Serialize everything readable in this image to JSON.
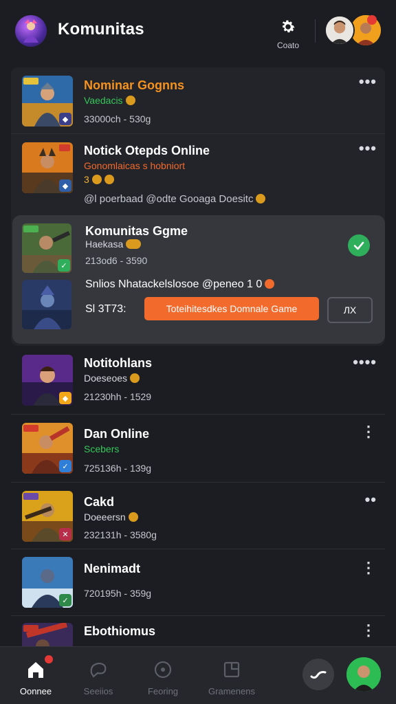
{
  "header": {
    "title": "Komunitas",
    "settings_label": "Coato"
  },
  "items": [
    {
      "title": "Nominar Gognns",
      "subtitle": "Vaedacis",
      "meta": "33000ch - 530g",
      "title_color": "#f6921e",
      "sub_color": "#35c759",
      "badge_color": "#3b3f8a"
    },
    {
      "title": "Notick Otepds Online",
      "subtitle": "Gonomlaicas s hobniort",
      "extra": "3",
      "meta": "@l poerbaad @odte Gooaga Doesitc",
      "sub_color": "#f26a2c",
      "badge_color": "#2f5fa8"
    }
  ],
  "selected": {
    "title": "Komunitas Ggme",
    "subtitle": "Haekasa",
    "meta": "213od6 - 3590",
    "description": "Snlios Nhatackelslosoe @peneo 1 0",
    "price": "Sl 3Т73:",
    "cta_label": "Toteihitesdkes Domnale Game",
    "cancel_label": "ЛX"
  },
  "lower_items": [
    {
      "title": "Notitohlans",
      "subtitle": "Doeseoes",
      "meta": "21230hh - 1529",
      "sub_color": "#d7d9e0",
      "more": "••••"
    },
    {
      "title": "Dan Online",
      "subtitle": "Scebers",
      "meta": "725136h - 139g",
      "sub_color": "#35c759",
      "more": "⋮"
    },
    {
      "title": "Cakd",
      "subtitle": "Doeeersn",
      "meta": "232131h - 3580g",
      "sub_color": "#d7d9e0",
      "more": "••"
    },
    {
      "title": "Nenimadt",
      "subtitle": "",
      "meta": "720195h - 359g",
      "sub_color": "#d7d9e0",
      "more": "⋮"
    },
    {
      "title": "Ebothiomus",
      "subtitle": "",
      "meta": "",
      "sub_color": "#d7d9e0",
      "more": "⋮"
    }
  ],
  "nav": {
    "home_label": "Oonnee",
    "second_label": "Seeiios",
    "third_label": "Feoring",
    "fourth_label": "Gramenens"
  },
  "colors": {
    "accent": "#f26a2c",
    "success": "#2fae5c",
    "background": "#1c1d22"
  }
}
